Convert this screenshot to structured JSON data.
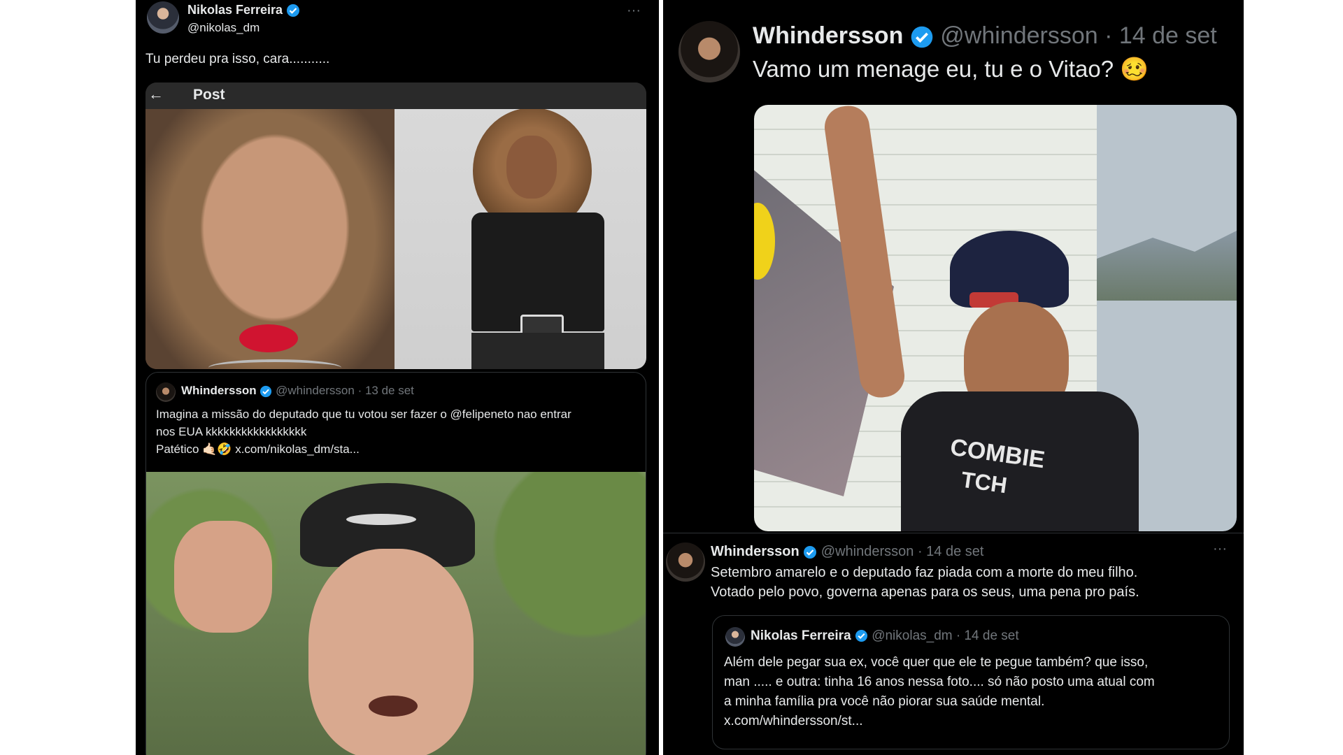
{
  "left": {
    "author": {
      "name": "Nikolas Ferreira",
      "handle": "@nikolas_dm"
    },
    "more": "···",
    "tweet_text": "Tu perdeu pra isso, cara...........",
    "post_header": {
      "back": "←",
      "title": "Post"
    },
    "quoted": {
      "name": "Whindersson",
      "handle_date": "@whindersson · 13 de set",
      "line1": "Imagina a missão do deputado que tu votou ser fazer o @felipeneto nao entrar",
      "line2": "nos EUA kkkkkkkkkkkkkkkkk",
      "line3": "Patético 🤙🏻🤣 x.com/nikolas_dm/sta..."
    }
  },
  "right": {
    "main": {
      "name": "Whindersson",
      "handle_date": "@whindersson · 14 de set",
      "text": "Vamo um menage eu, tu e o Vitao? 🥴"
    },
    "photo_shirt": {
      "line1": "COMBIE",
      "line2": "TCH"
    },
    "reply": {
      "name": "Whindersson",
      "handle_date": "@whindersson · 14 de set",
      "more": "···",
      "line1": "Setembro amarelo e o deputado faz piada com a morte do meu filho.",
      "line2": "Votado pelo povo, governa apenas para os seus, uma pena pro país."
    },
    "quoted": {
      "name": "Nikolas Ferreira",
      "handle_date": "@nikolas_dm · 14 de set",
      "line1": "Além dele pegar sua ex, você quer que ele te pegue também? que isso,",
      "line2": "man ..... e outra: tinha 16 anos nessa foto.... só não posto uma atual com",
      "line3": "a minha família pra você não piorar sua saúde mental.",
      "line4": "x.com/whindersson/st..."
    }
  },
  "colors": {
    "verified": "#1d9bf0",
    "background": "#000000",
    "muted_text": "#71767b"
  }
}
